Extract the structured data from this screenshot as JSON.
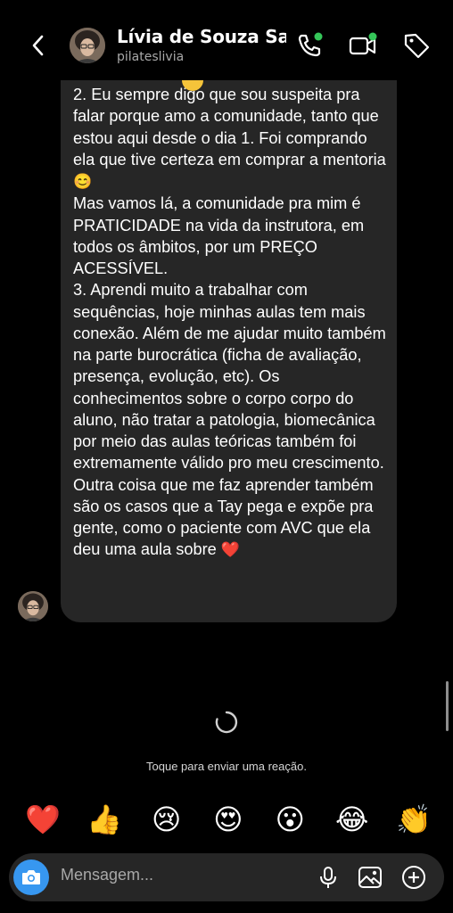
{
  "header": {
    "contact_name": "Lívia de Souza Sa...",
    "username": "pilateslivia",
    "icons": [
      "back-chevron-icon",
      "phone-icon",
      "video-camera-icon",
      "tag-icon"
    ],
    "active_dot_color": "#35c659"
  },
  "message": {
    "paragraphs": [
      "2. Eu sempre digo que sou suspeita pra falar porque amo a comunidade, tanto que estou aqui desde o dia 1. Foi comprando ela que tive certeza em comprar a mentoria",
      "Mas vamos lá, a comunidade pra mim é PRATICIDADE na vida da instrutora, em todos os âmbitos, por um PREÇO ACESSÍVEL.",
      "3. Aprendi muito a trabalhar com sequências, hoje minhas aulas tem mais conexão. Além de me ajudar muito também na parte burocrática (ficha de avaliação, presença, evolução, etc). Os conhecimentos sobre o corpo corpo do aluno, não tratar a patologia, biomecânica por meio das aulas teóricas também foi extremamente válido pro meu crescimento. Outra coisa que me faz aprender também são os casos que a Tay pega e expõe pra gente, como o paciente com AVC que ela deu uma aula sobre"
    ],
    "emoji_1": "😊",
    "emoji_2": "❤️",
    "bubble_color": "#262626"
  },
  "reaction_hint": "Toque para enviar uma reação.",
  "reactions": [
    "❤️",
    "👍",
    "😢",
    "😍",
    "😮",
    "😂",
    "👏"
  ],
  "composer": {
    "placeholder": "Mensagem...",
    "camera_color": "#3797f0",
    "icons": [
      "camera-icon",
      "microphone-icon",
      "gallery-icon",
      "plus-circle-icon"
    ]
  }
}
